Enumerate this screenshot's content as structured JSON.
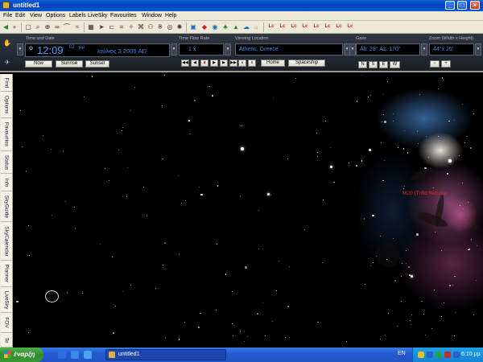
{
  "window": {
    "title": "untitled1"
  },
  "menu": [
    "File",
    "Edit",
    "View",
    "Options",
    "Labels",
    "LiveSky",
    "Favourites",
    "Window",
    "Help"
  ],
  "toolbar": {
    "labels": [
      "Lc",
      "Lc",
      "Lc",
      "Lc",
      "Lc",
      "Lc",
      "Lc",
      "Lc"
    ]
  },
  "controls": {
    "time_group_label": "Time and Date",
    "time": "12:09",
    "seconds": "02",
    "period": "μμ",
    "date": "Ιούλιος  3  2005 AD",
    "now": "Now",
    "sunrise": "Sunrise",
    "sunset": "Sunset",
    "flow_label": "Time Flow Rate",
    "flow_value": "1 x",
    "location_label": "Viewing Location",
    "location_value": "Athens, Greece",
    "home": "Home",
    "spaceship": "Spaceship",
    "gaze_label": "Gaze",
    "gaze_value": "Alt: 28° Az: 170°",
    "compass": [
      "N",
      "S",
      "E",
      "W"
    ],
    "zoom_label": "Zoom (Width x Height)",
    "zoom_value": "44°x 25'",
    "zoom_out": "−",
    "zoom_in": "+"
  },
  "side_tabs": [
    "Find",
    "Options",
    "Favourites",
    "Status",
    "Info",
    "SkyGuide",
    "SkyCalendar",
    "Planner",
    "LiveSky",
    "FOV",
    "Te"
  ],
  "sky": {
    "nebula_label": "M20 (Trifid Nebula)"
  },
  "taskbar": {
    "start": "έναρξη",
    "task": "untitled1",
    "lang": "EN",
    "clock": "6:10 μμ"
  },
  "colors": {
    "title_bar": "#0a55d0",
    "lcd_text": "#3a8cf0",
    "label_red": "#d0302a",
    "start_green": "#3b9b36"
  }
}
